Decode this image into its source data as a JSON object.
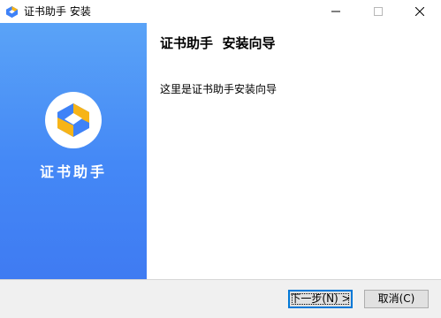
{
  "window": {
    "title": "证书助手 安装",
    "icons": {
      "app": "app-logo-icon",
      "minimize": "minimize-icon",
      "maximize": "maximize-icon",
      "close": "close-icon"
    }
  },
  "sidebar": {
    "app_name": "证书助手",
    "logo_icon": "app-logo-icon",
    "colors": {
      "gradient_top": "#5aa3f7",
      "gradient_bottom": "#3f7bf2",
      "logo_blue": "#3f82f7",
      "logo_yellow": "#f7b418"
    }
  },
  "content": {
    "heading": "证书助手  安装向导",
    "description": "这里是证书助手安装向导"
  },
  "footer": {
    "next_button": "下一步(N) >",
    "cancel_button": "取消(C)"
  }
}
